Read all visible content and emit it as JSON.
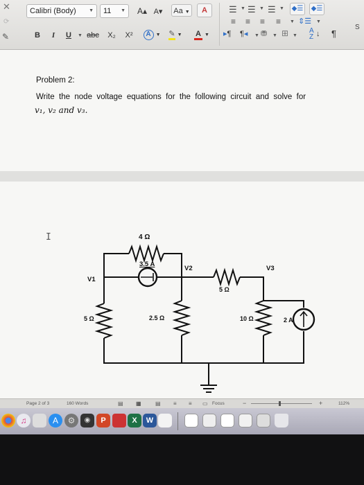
{
  "ribbon": {
    "font_name": "Calibri (Body)",
    "font_size": "11",
    "bold": "B",
    "italic": "I",
    "underline": "U",
    "strike": "abc",
    "subscript": "X₂",
    "superscript": "X²",
    "grow": "A▴",
    "shrink": "A▾",
    "change_case": "Aa",
    "text_effects": "A",
    "highlight": "✎",
    "font_color": "A",
    "sort": "↓",
    "pilcrow": "¶",
    "ltr": "¶",
    "rtl": "¶",
    "clipped_label": "S",
    "accent_blue": "#2f6fc8",
    "accent_red": "#d7261e"
  },
  "document": {
    "problem_title": "Problem 2:",
    "problem_line1": "Write  the  node  voltage  equations  for  the  following  circuit  and  solve  for",
    "problem_line2": "v₁, v₂ and v₃."
  },
  "circuit": {
    "r_top": "4 Ω",
    "dep_source": "3.5 A",
    "node_v1": "V1",
    "node_v2": "V2",
    "node_v3": "V3",
    "r_mid": "5 Ω",
    "r_left": "5 Ω",
    "r_center": "2.5 Ω",
    "r_right": "10 Ω",
    "src_right": "2 A"
  },
  "statusbar": {
    "page": "Page 2 of 3",
    "words": "160 Words",
    "focus": "Focus",
    "zoom": "112%",
    "minus": "−",
    "plus": "+"
  },
  "dock": {
    "excel": "X",
    "word": "W",
    "powerpoint": "P"
  }
}
